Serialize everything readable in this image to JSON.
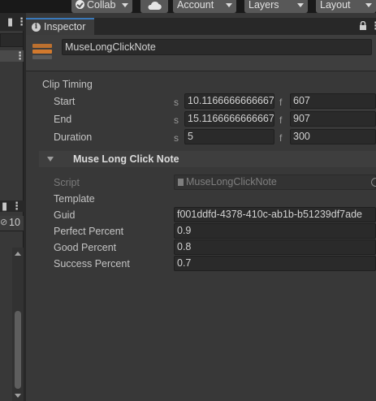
{
  "toolbar": {
    "collab_label": "Collab",
    "account_label": "Account",
    "layers_label": "Layers",
    "layout_label": "Layout"
  },
  "left_panel": {
    "visibility_count": "10"
  },
  "inspector": {
    "tab_label": "Inspector",
    "object_name": "MuseLongClickNote"
  },
  "clip_timing": {
    "title": "Clip Timing",
    "rows": [
      {
        "label": "Start",
        "seconds_unit": "s",
        "seconds": "10.1166666666667",
        "frames_unit": "f",
        "frames": "607"
      },
      {
        "label": "End",
        "seconds_unit": "s",
        "seconds": "15.1166666666667",
        "frames_unit": "f",
        "frames": "907"
      },
      {
        "label": "Duration",
        "seconds_unit": "s",
        "seconds": "5",
        "frames_unit": "f",
        "frames": "300"
      }
    ]
  },
  "component": {
    "title": "Muse Long Click Note",
    "script_label": "Script",
    "script_value": "MuseLongClickNote",
    "template_label": "Template",
    "guid_label": "Guid",
    "guid_value": "f001ddfd-4378-410c-ab1b-b51239df7ade",
    "perfect_label": "Perfect Percent",
    "perfect_value": "0.9",
    "good_label": "Good Percent",
    "good_value": "0.8",
    "success_label": "Success Percent",
    "success_value": "0.7"
  },
  "colors": {
    "accent_tab": "#3a79bb",
    "object_icon": "#d2792d",
    "panel_bg": "#383838"
  }
}
